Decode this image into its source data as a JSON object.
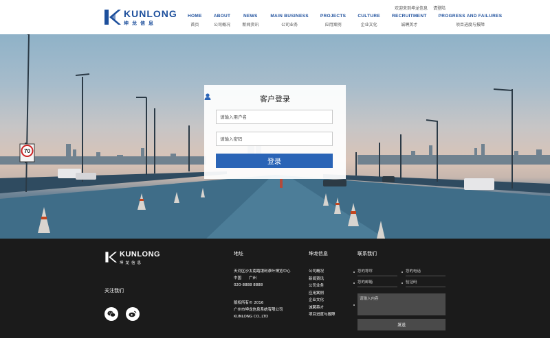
{
  "brand": {
    "name": "KUNLONG",
    "cn_name": "坤龙信息",
    "accent": "#1d4f9c"
  },
  "topbar": {
    "welcome": "欢迎来到坤龙信息",
    "login_link": "请登陆"
  },
  "nav": [
    {
      "en": "HOME",
      "zh": "首页"
    },
    {
      "en": "ABOUT",
      "zh": "公司概况"
    },
    {
      "en": "NEWS",
      "zh": "新闻资讯"
    },
    {
      "en": "MAIN BUSINESS",
      "zh": "公司业务"
    },
    {
      "en": "PROJECTS",
      "zh": "应用案例"
    },
    {
      "en": "CULTURE",
      "zh": "企业文化"
    },
    {
      "en": "RECRUITMENT",
      "zh": "诚聘英才"
    },
    {
      "en": "PROGRESS AND FAILURES",
      "zh": "项目进度与报障"
    }
  ],
  "hero": {
    "speed_sign": "70"
  },
  "login": {
    "title": "客户登录",
    "username_placeholder": "请输入用户名",
    "password_placeholder": "请输入密码",
    "submit_label": "登录",
    "button_color": "#2a64b6"
  },
  "footer": {
    "follow_title": "关注我们",
    "address_title": "地址",
    "address_lines": [
      "天河区沙太南路银利茶叶博览中心",
      "中国　　广州",
      "020-8888 8888"
    ],
    "copyright_lines": [
      "版权所有© 2016",
      "广州市坤龙信息系统有限公司",
      "KUNLONG CO.,LTD"
    ],
    "links_title": "坤龙信息",
    "links": [
      "公司概况",
      "新闻资讯",
      "公司业务",
      "应用案例",
      "企业文化",
      "诚聘英才",
      "项目进度与报障"
    ],
    "contact_title": "联系我们",
    "contact": {
      "name_placeholder": "您的称呼",
      "phone_placeholder": "您的电话",
      "email_placeholder": "您的邮箱",
      "code_placeholder": "验证码",
      "message_placeholder": "请输入内容",
      "send_label": "发送"
    }
  }
}
